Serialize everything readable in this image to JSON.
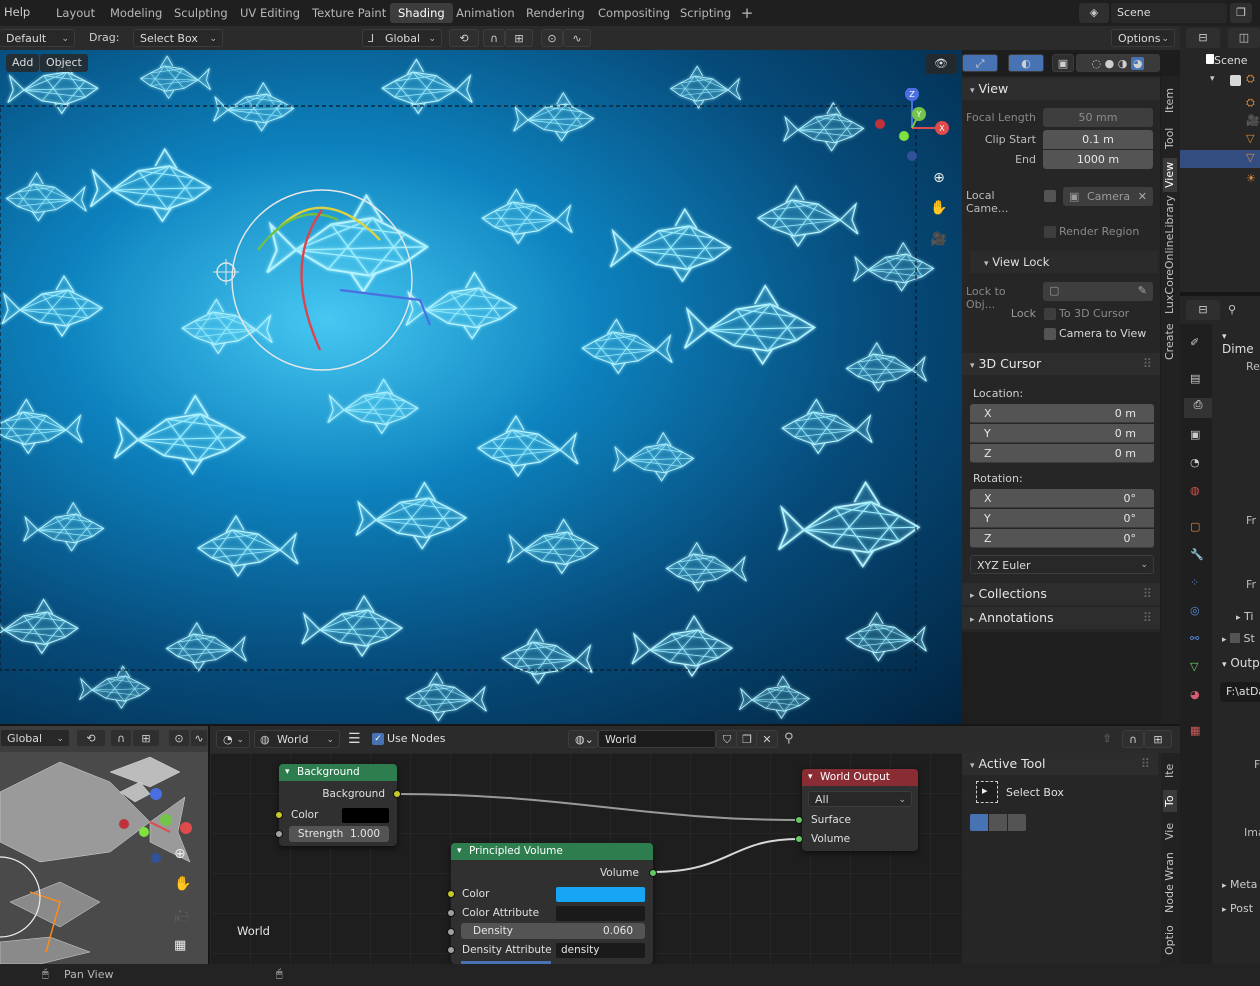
{
  "menu": {
    "help": "Help"
  },
  "workspaces": [
    "Layout",
    "Modeling",
    "Sculpting",
    "UV Editing",
    "Texture Paint",
    "Shading",
    "Animation",
    "Rendering",
    "Compositing",
    "Scripting"
  ],
  "active_workspace": "Shading",
  "plus": "+",
  "scene": {
    "name": "Scene",
    "tree_label": "Scene"
  },
  "header": {
    "orientation": "Default",
    "drag_label": "Drag:",
    "drag_value": "Select Box",
    "transform": "Global",
    "options": "Options"
  },
  "viewport_menu": {
    "add": "Add",
    "object": "Object"
  },
  "npanel": {
    "view_title": "View",
    "focal_length_label": "Focal Length",
    "focal_length": "50 mm",
    "clip_start_label": "Clip Start",
    "clip_start": "0.1 m",
    "end_label": "End",
    "clip_end": "1000 m",
    "local_camera_label": "Local Came...",
    "camera_value": "Camera",
    "render_region": "Render Region",
    "view_lock_title": "View Lock",
    "lock_to_obj_label": "Lock to Obj...",
    "lock_label": "Lock",
    "to_3d_cursor": "To 3D Cursor",
    "camera_to_view": "Camera to View",
    "cursor_title": "3D Cursor",
    "location_label": "Location:",
    "location": [
      {
        "axis": "X",
        "value": "0 m"
      },
      {
        "axis": "Y",
        "value": "0 m"
      },
      {
        "axis": "Z",
        "value": "0 m"
      }
    ],
    "rotation_label": "Rotation:",
    "rotation": [
      {
        "axis": "X",
        "value": "0°"
      },
      {
        "axis": "Y",
        "value": "0°"
      },
      {
        "axis": "Z",
        "value": "0°"
      }
    ],
    "rotation_mode": "XYZ Euler",
    "collections": "Collections",
    "annotations": "Annotations"
  },
  "vtabs_top": [
    "Item",
    "Tool",
    "View",
    "LuxCoreOnlineLibrary",
    "Create"
  ],
  "vtabs_bottom": [
    "Ite",
    "To",
    "Vie",
    "Node Wran",
    "Optio"
  ],
  "right_props": {
    "dimensions": "Dime",
    "re": "Re",
    "fr1": "Fr",
    "fr2": "Fr",
    "ti": "Ti",
    "st": "St",
    "output": "Outp",
    "path": "F:\\atDa",
    "f": "F",
    "image": "Image",
    "meta": "Meta",
    "post": "Post"
  },
  "node_header": {
    "transform": "Global",
    "world_type": "World",
    "use_nodes": "Use Nodes",
    "world_name": "World"
  },
  "node_area_label": "World",
  "nodes": {
    "background": {
      "title": "Background",
      "output": "Background",
      "color_label": "Color",
      "strength_label": "Strength",
      "strength": "1.000",
      "header_color": "#2e7d4f"
    },
    "principled_volume": {
      "title": "Principled Volume",
      "output": "Volume",
      "color_label": "Color",
      "color_attr_label": "Color Attribute",
      "density_label": "Density",
      "density": "0.060",
      "density_attr_label": "Density Attribute",
      "density_attr": "density",
      "color_value": "#16a6f5"
    },
    "world_output": {
      "title": "World Output",
      "target": "All",
      "surface": "Surface",
      "volume": "Volume",
      "header_color": "#8a2c34"
    }
  },
  "active_tool": {
    "title": "Active Tool",
    "tool": "Select Box"
  },
  "status": {
    "pan_view": "Pan View"
  },
  "colors": {
    "accent": "#4772b3",
    "viewport_glow": "#46c8f2",
    "socket_yellow": "#c7c729",
    "socket_green": "#63c763",
    "socket_gray": "#a1a1a1"
  }
}
